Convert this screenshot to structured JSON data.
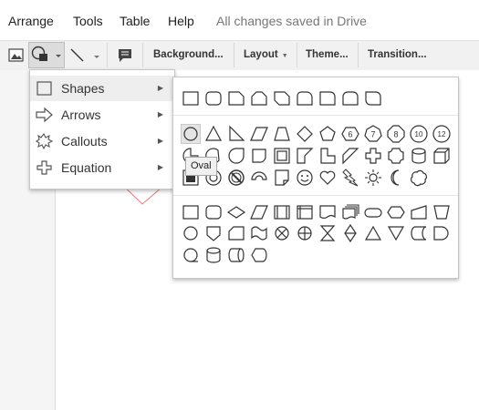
{
  "menubar": {
    "items": [
      "Arrange",
      "Tools",
      "Table",
      "Help"
    ],
    "status": "All changes saved in Drive"
  },
  "toolbar": {
    "background_label": "Background...",
    "layout_label": "Layout",
    "theme_label": "Theme...",
    "transition_label": "Transition..."
  },
  "shape_menu": {
    "items": [
      {
        "label": "Shapes",
        "icon": "rectangle-icon"
      },
      {
        "label": "Arrows",
        "icon": "arrow-icon"
      },
      {
        "label": "Callouts",
        "icon": "callout-icon"
      },
      {
        "label": "Equation",
        "icon": "plus-icon"
      }
    ]
  },
  "palette": {
    "tooltip": "Oval",
    "number_labels": [
      "6",
      "7",
      "8",
      "10",
      "12"
    ]
  }
}
